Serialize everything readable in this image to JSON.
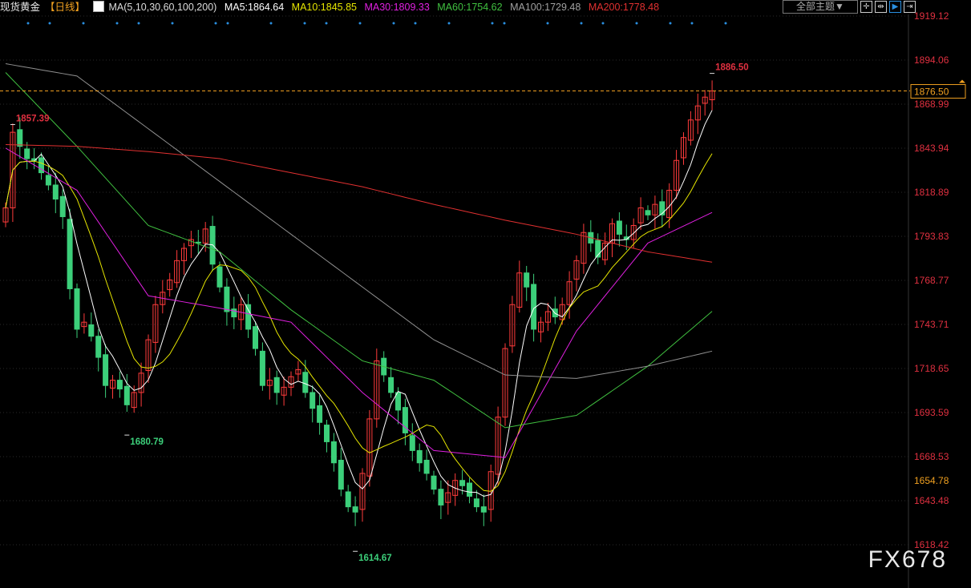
{
  "header": {
    "symbol": "现货黄金",
    "period": "【日线】",
    "ma_params": "MA(5,10,30,60,100,200)",
    "ma5": "MA5:1864.64",
    "ma10": "MA10:1845.85",
    "ma30": "MA30:1809.33",
    "ma60": "MA60:1754.62",
    "ma100": "MA100:1729.48",
    "ma200": "MA200:1778.48"
  },
  "toolbar": {
    "theme_label": "全部主题▼",
    "icons": [
      "crosshair-icon",
      "range-icon",
      "play-icon",
      "shift-right-icon"
    ]
  },
  "watermark": "FX678",
  "colors": {
    "up": "#ff3b3b",
    "down": "#3ccf7a",
    "ma5": "#ffffff",
    "ma10": "#e6e600",
    "ma30": "#e020e0",
    "ma60": "#40c040",
    "ma100": "#909090",
    "ma200": "#e03030",
    "axis": "#e03040",
    "current": "#f0a020"
  },
  "chart_data": {
    "type": "candlestick",
    "title": "现货黄金 日线",
    "ylim": [
      1618.42,
      1919.12
    ],
    "y_ticks": [
      "1919.12",
      "1894.06",
      "1868.99",
      "1843.94",
      "1818.89",
      "1793.83",
      "1768.77",
      "1743.71",
      "1718.65",
      "1693.59",
      "1668.53",
      "1643.48",
      "1618.42"
    ],
    "current_price": "1876.50",
    "marker_price": "1654.78",
    "annotations": [
      {
        "text": "1857.39",
        "index": 1,
        "value": 1857.39,
        "kind": "high"
      },
      {
        "text": "1680.79",
        "index": 17,
        "value": 1680.79,
        "kind": "low"
      },
      {
        "text": "1614.67",
        "index": 49,
        "value": 1614.67,
        "kind": "low"
      },
      {
        "text": "1886.50",
        "index": 99,
        "value": 1886.5,
        "kind": "high"
      }
    ],
    "closes": [
      1810,
      1853,
      1845,
      1838,
      1837,
      1830,
      1823,
      1815,
      1805,
      1764,
      1741,
      1745,
      1737,
      1725,
      1709,
      1712,
      1707,
      1698,
      1705,
      1716,
      1735,
      1755,
      1762,
      1769,
      1780,
      1787,
      1792,
      1790,
      1798,
      1778,
      1765,
      1751,
      1748,
      1755,
      1741,
      1730,
      1709,
      1712,
      1705,
      1708,
      1714,
      1718,
      1705,
      1696,
      1688,
      1677,
      1665,
      1650,
      1640,
      1637,
      1659,
      1690,
      1723,
      1715,
      1705,
      1695,
      1682,
      1672,
      1665,
      1659,
      1650,
      1641,
      1648,
      1655,
      1652,
      1646,
      1640,
      1637,
      1660,
      1691,
      1730,
      1755,
      1773,
      1765,
      1741,
      1745,
      1751,
      1748,
      1755,
      1768,
      1780,
      1796,
      1790,
      1782,
      1790,
      1801,
      1795,
      1792,
      1800,
      1810,
      1806,
      1812,
      1806,
      1820,
      1837,
      1850,
      1860,
      1868,
      1873,
      1876.5
    ],
    "ma_samples_every_10": {
      "MA30": [
        1844,
        1820,
        1760,
        1753,
        1745,
        1705,
        1672,
        1668,
        1740,
        1790,
        1809.33
      ],
      "MA60": [
        1887,
        1845,
        1800,
        1785,
        1752,
        1723,
        1712,
        1685,
        1692,
        1720,
        1754.62
      ],
      "MA100": [
        1892,
        1885,
        1855,
        1825,
        1795,
        1765,
        1735,
        1715,
        1713,
        1720,
        1729.48
      ],
      "MA200": [
        1846,
        1845,
        1842,
        1838,
        1830,
        1822,
        1812,
        1803,
        1795,
        1785,
        1778.48
      ]
    }
  }
}
